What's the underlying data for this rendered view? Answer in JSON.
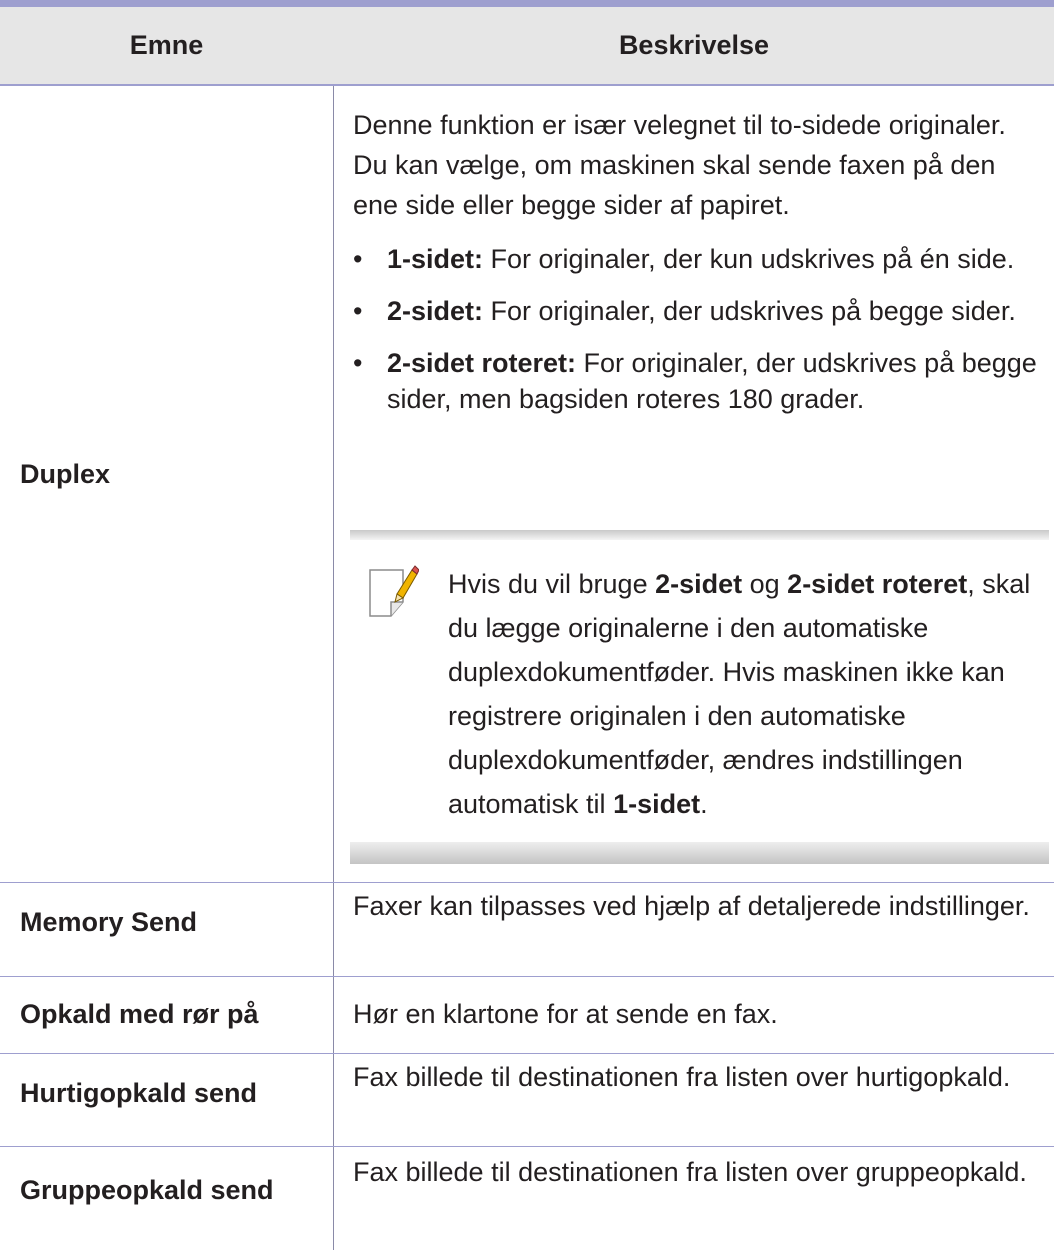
{
  "table": {
    "header": {
      "subject": "Emne",
      "description": "Beskrivelse"
    },
    "rows": [
      {
        "subject": "Duplex",
        "intro": "Denne funktion er især velegnet til to-sidede originaler. Du kan vælge, om maskinen skal sende faxen på den ene side eller begge sider af papiret.",
        "bullets": [
          {
            "term": "1-sidet:",
            "text": " For originaler, der kun udskrives på én side."
          },
          {
            "term": "2-sidet:",
            "text": " For originaler, der udskrives på begge sider."
          },
          {
            "term": "2-sidet roteret:",
            "text": " For originaler, der udskrives på begge sider, men bagsiden roteres 180 grader."
          }
        ],
        "note": {
          "t1": "Hvis du vil bruge ",
          "b1": "2-sidet",
          "t2": " og ",
          "b2": "2-sidet roteret",
          "t3": ", skal du lægge originalerne i den automatiske duplexdokumentføder. Hvis maskinen ikke kan registrere originalen i den automatiske duplexdokumentføder, ændres indstillingen automatisk til ",
          "b3": "1-sidet",
          "t4": "."
        }
      },
      {
        "subject": "Memory Send",
        "description": "Faxer kan tilpasses ved hjælp af detaljerede indstillinger."
      },
      {
        "subject": "Opkald med rør på",
        "description": "Hør en klartone for at sende en fax."
      },
      {
        "subject": "Hurtigopkald send",
        "description": "Fax billede til destinationen fra listen over hurtigopkald."
      },
      {
        "subject": "Gruppeopkald send",
        "description": "Fax billede til destinationen fra listen over gruppeopkald."
      }
    ]
  },
  "colors": {
    "header_bg": "#e6e6e6",
    "rule": "#9e9fcf",
    "text": "#231f20",
    "note_icon_accent": "#f0b400"
  },
  "icons": {
    "note": "note-pencil-icon"
  }
}
